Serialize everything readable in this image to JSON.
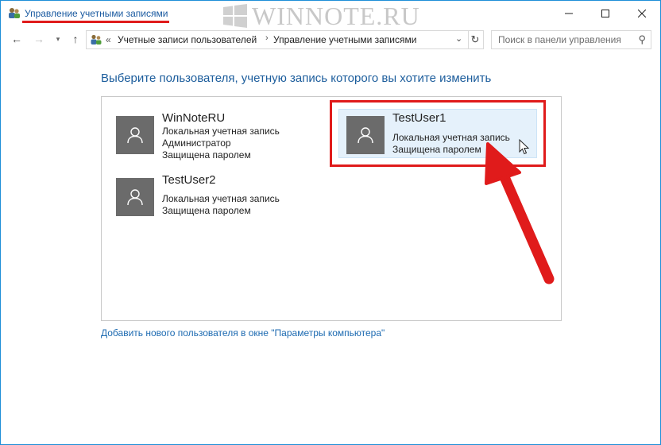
{
  "window": {
    "title": "Управление учетными записями",
    "watermark": "WINNOTE.RU",
    "minimize_icon": "minimize-icon",
    "maximize_icon": "maximize-icon",
    "close_icon": "close-icon"
  },
  "nav": {
    "breadcrumb_overflow": "«",
    "crumbs": [
      "Учетные записи пользователей",
      "Управление учетными записями"
    ],
    "crumb_separator": "›",
    "search_placeholder": "Поиск в панели управления"
  },
  "heading": "Выберите пользователя, учетную запись которого вы хотите изменить",
  "users": [
    {
      "name": "WinNoteRU",
      "lines": [
        "Локальная учетная запись",
        "Администратор",
        "Защищена паролем"
      ]
    },
    {
      "name": "TestUser1",
      "lines": [
        "Локальная учетная запись",
        "Защищена паролем"
      ],
      "selected": true
    },
    {
      "name": "TestUser2",
      "lines": [
        "Локальная учетная запись",
        "Защищена паролем"
      ]
    }
  ],
  "add_user_link": "Добавить нового пользователя в окне \"Параметры компьютера\"",
  "colors": {
    "accent": "#1c5d9c",
    "annotation_red": "#e01b1b",
    "avatar_bg": "#6b6b6b",
    "selected_bg": "#e5f1fb"
  }
}
